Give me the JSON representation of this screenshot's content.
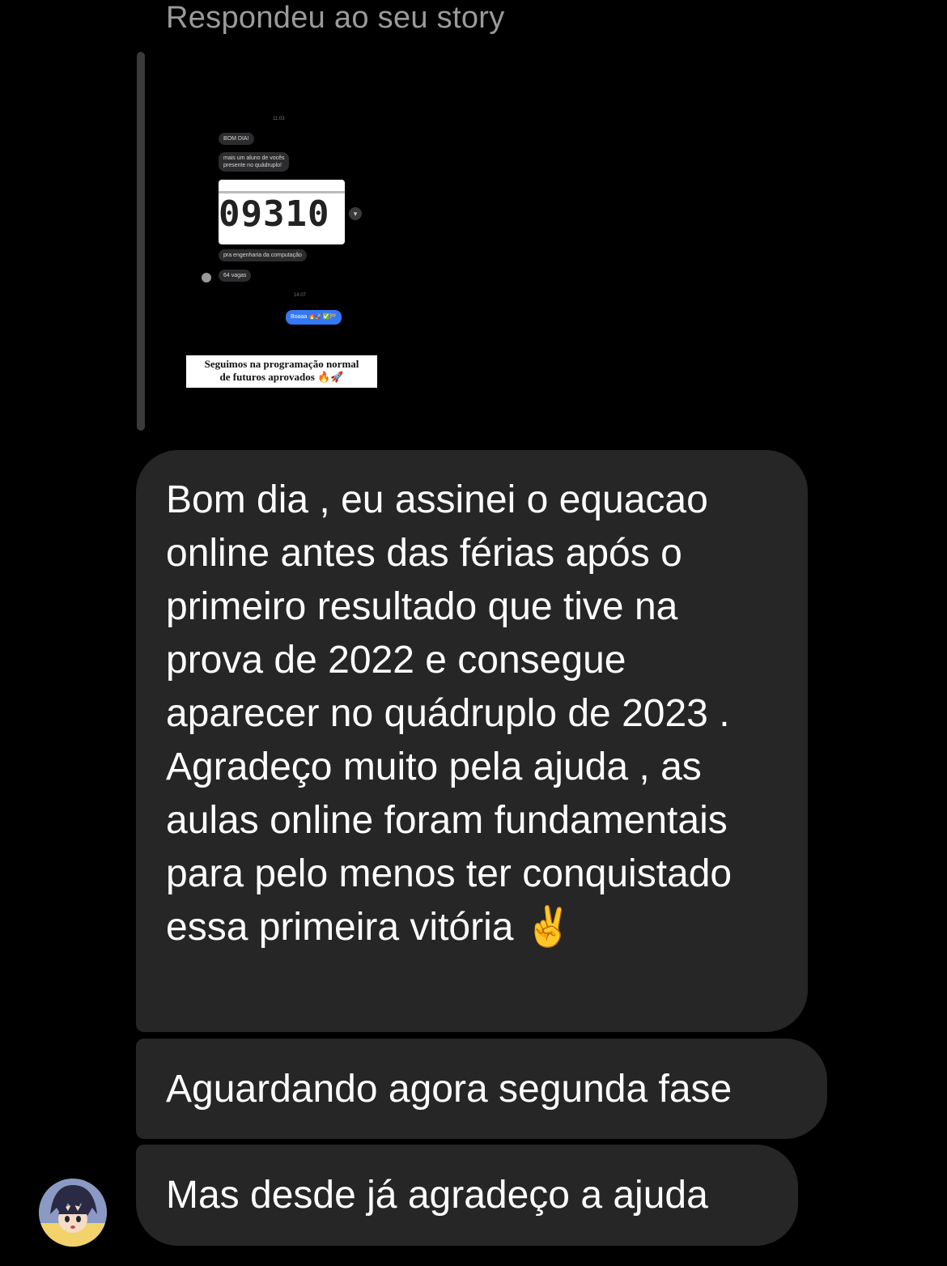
{
  "reply_header": "Respondeu ao seu story",
  "story": {
    "time1": "11:03",
    "bubble1": "BOM DIA!",
    "bubble2_line1": "mais um aluno de vocês",
    "bubble2_line2": "presente no quádruplo!",
    "number": "09310",
    "bubble3": "pra engenharia da computação",
    "bubble4": "64 vagas",
    "time2": "14:07",
    "reply_bubble": "Boaaa 🔥🚀✅🏁",
    "caption_line1": "Seguimos na programação normal",
    "caption_line2": "de futuros aprovados 🔥🚀"
  },
  "messages": [
    {
      "text": "Bom dia , eu assinei o equacao online antes das férias após o primeiro resultado que tive na prova de 2022 e consegue aparecer no quádruplo de 2023 . Agradeço muito pela ajuda , as aulas online foram fundamentais para pelo menos ter conquistado essa primeira vitória ✌️"
    },
    {
      "text": "Aguardando agora segunda fase"
    },
    {
      "text": "Mas desde já agradeço a ajuda"
    }
  ],
  "sender_avatar": "anime-character-avatar",
  "colors": {
    "background": "#000000",
    "bubble": "#262626",
    "reply_header": "#9a9a9a",
    "reply_bar": "#3a3a3c",
    "story_blue": "#3478f6"
  }
}
